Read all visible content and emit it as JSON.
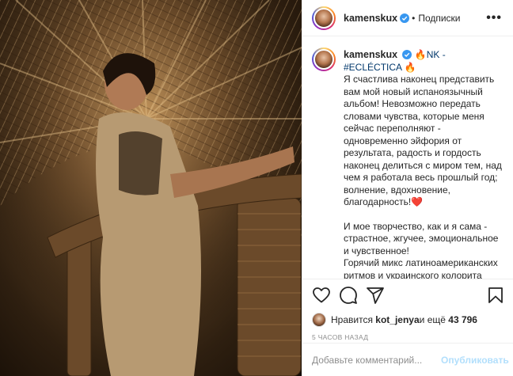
{
  "post": {
    "username": "kamenskux",
    "dot": "•",
    "follow_label": "Подписки",
    "more_label": "•••",
    "photo_alt": "post-photo"
  },
  "caption": {
    "username": "kamenskux",
    "headline": "🔥NK - #ECLÉCTICA 🔥",
    "paragraph1": "Я счастлива наконец представить вам мой новый испаноязычный альбом! Невозможно передать словами чувства, которые меня сейчас переполняют - одновременно эйфория от результата, радость и гордость наконец делиться с миром тем, над чем я работала весь прошлый год; волнение, вдохновение, благодарность!❤️",
    "paragraph2": "И мое творчество, как и я сама - страстное, жгучее, эмоциональное и чувственное!\nГорячий микс латиноамериканских ритмов и украинского колорита чувствуется в каждой песне"
  },
  "likes": {
    "prefix": "Нравится ",
    "user": "kot_jenya",
    "middle": " и ещё ",
    "count": "43 796"
  },
  "timestamp": "5 часов назад",
  "comment": {
    "placeholder": "Добавьте комментарий...",
    "post_label": "Опубликовать"
  },
  "colors": {
    "link": "#00376b",
    "verified": "#3897f0",
    "post_disabled": "#b2dffc",
    "muted": "#8e8e8e"
  }
}
